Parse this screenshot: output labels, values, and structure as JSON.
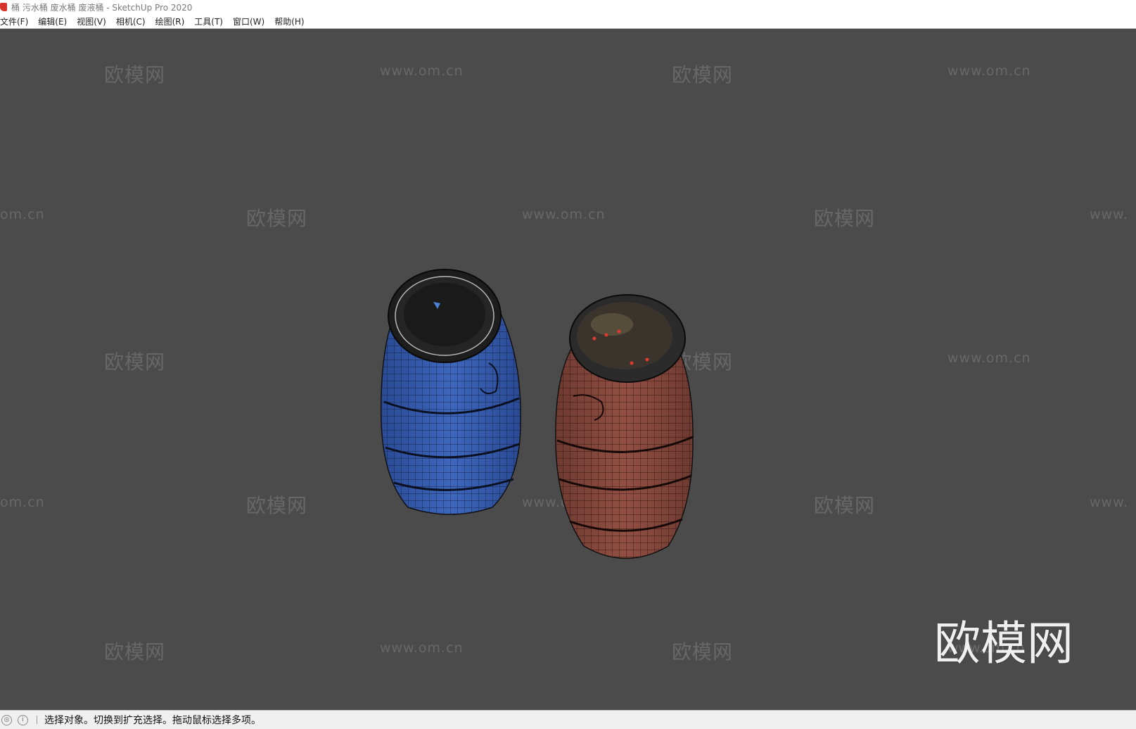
{
  "window": {
    "title": "桶 污水桶 废水桶 废液桶 - SketchUp Pro 2020"
  },
  "menu": {
    "items": [
      {
        "label": "文件(F)"
      },
      {
        "label": "编辑(E)"
      },
      {
        "label": "视图(V)"
      },
      {
        "label": "相机(C)"
      },
      {
        "label": "绘图(R)"
      },
      {
        "label": "工具(T)"
      },
      {
        "label": "窗口(W)"
      },
      {
        "label": "帮助(H)"
      }
    ]
  },
  "watermarks": {
    "brand": "欧模网",
    "url": "www.om.cn",
    "url_partial_left": "om.cn",
    "url_partial_right": "www."
  },
  "statusbar": {
    "hint": "选择对象。切换到扩充选择。拖动鼠标选择多项。"
  },
  "colors": {
    "viewport_bg": "#4b4b4b",
    "blue_barrel": "#3a5fb0",
    "red_barrel": "#8a4a3e"
  }
}
